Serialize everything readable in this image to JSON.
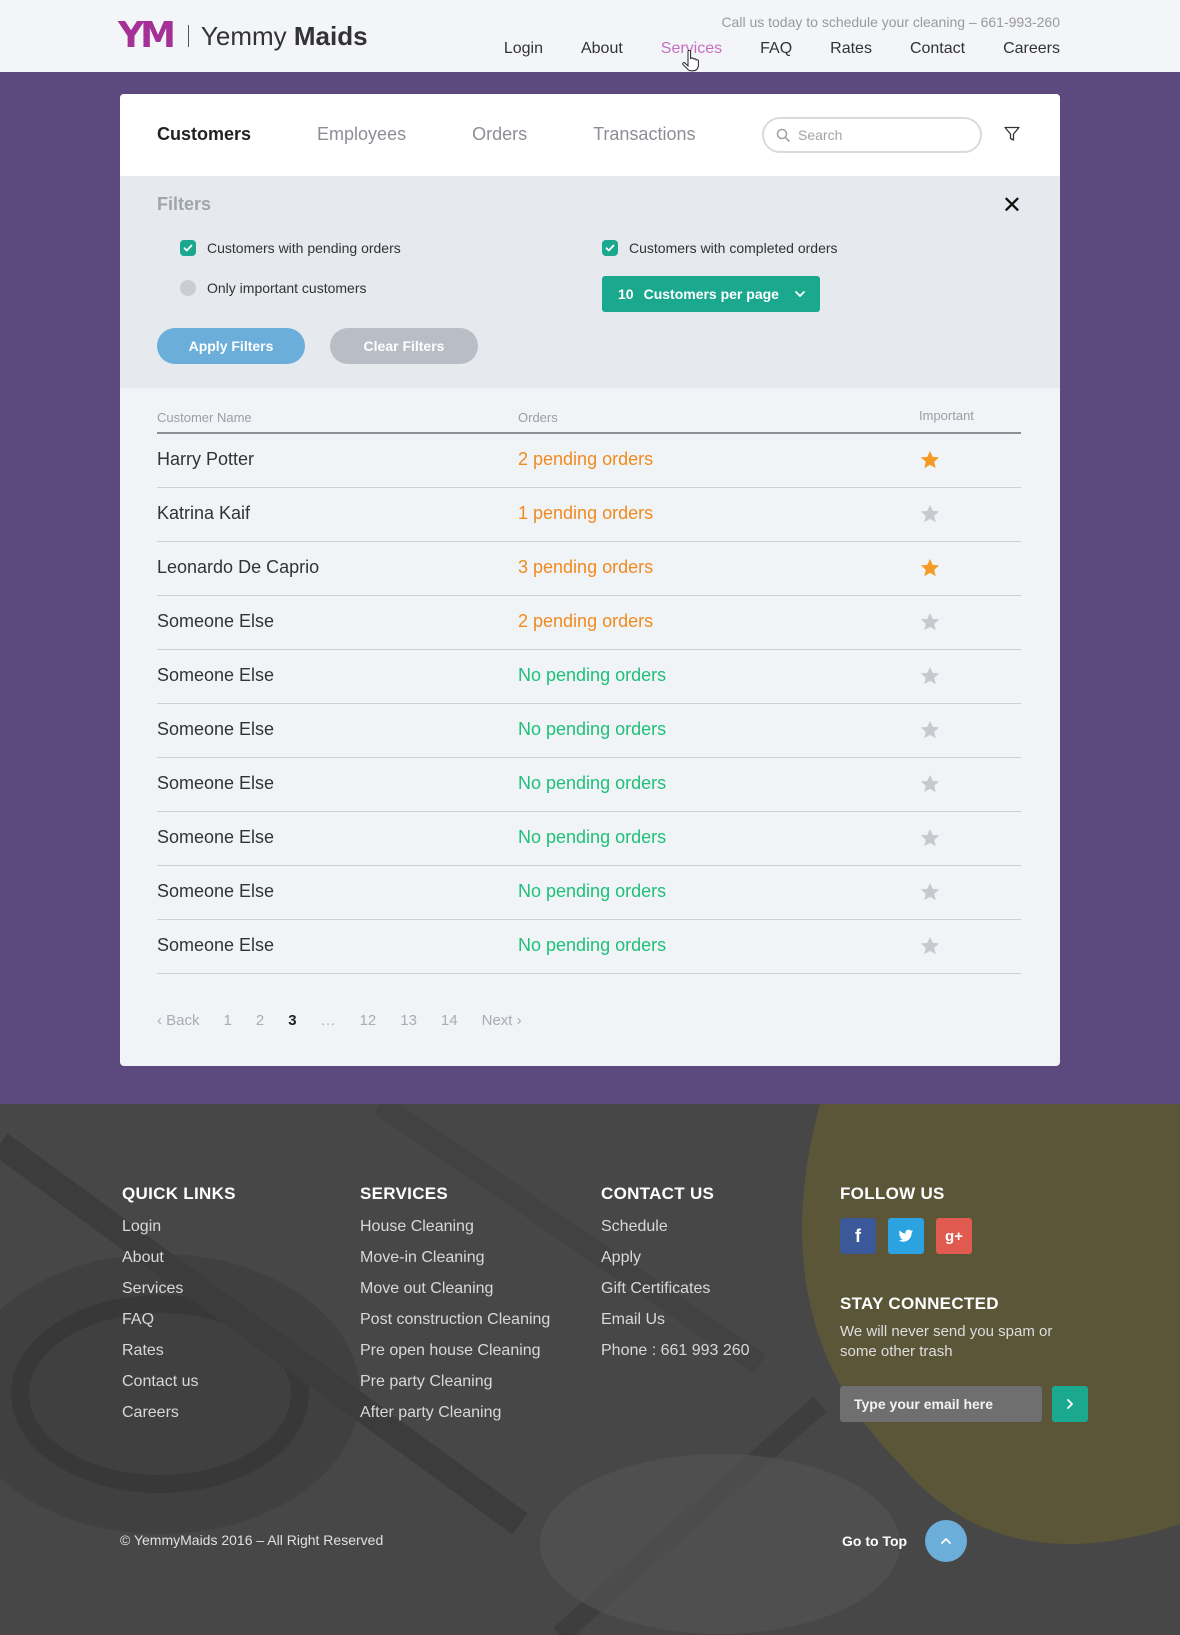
{
  "header": {
    "logo_mark": "YM",
    "logo_text_light": "Yemmy",
    "logo_text_bold": "Maids",
    "callus": "Call us today to schedule your cleaning – 661-993-260",
    "nav": [
      "Login",
      "About",
      "Services",
      "FAQ",
      "Rates",
      "Contact",
      "Careers"
    ],
    "active_nav": "Services"
  },
  "tabs": [
    "Customers",
    "Employees",
    "Orders",
    "Transactions"
  ],
  "active_tab": "Customers",
  "search": {
    "placeholder": "Search"
  },
  "filters": {
    "title": "Filters",
    "pending": "Customers with pending orders",
    "completed": "Customers with completed orders",
    "important": "Only important customers",
    "per_page_count": "10",
    "per_page_label": "Customers per page",
    "apply": "Apply Filters",
    "clear": "Clear Filters"
  },
  "table": {
    "headers": {
      "name": "Customer Name",
      "orders": "Orders",
      "important": "Important"
    },
    "rows": [
      {
        "name": "Harry Potter",
        "orders": "2 pending orders",
        "status": "pending",
        "important": true
      },
      {
        "name": "Katrina Kaif",
        "orders": "1 pending orders",
        "status": "pending",
        "important": false
      },
      {
        "name": "Leonardo De Caprio",
        "orders": "3 pending orders",
        "status": "pending",
        "important": true
      },
      {
        "name": "Someone Else",
        "orders": "2 pending orders",
        "status": "pending",
        "important": false
      },
      {
        "name": "Someone Else",
        "orders": "No pending orders",
        "status": "none",
        "important": false
      },
      {
        "name": "Someone Else",
        "orders": "No pending orders",
        "status": "none",
        "important": false
      },
      {
        "name": "Someone Else",
        "orders": "No pending orders",
        "status": "none",
        "important": false
      },
      {
        "name": "Someone Else",
        "orders": "No pending orders",
        "status": "none",
        "important": false
      },
      {
        "name": "Someone Else",
        "orders": "No pending orders",
        "status": "none",
        "important": false
      },
      {
        "name": "Someone Else",
        "orders": "No pending orders",
        "status": "none",
        "important": false
      }
    ]
  },
  "pager": {
    "back": "‹ Back",
    "pages": [
      "1",
      "2",
      "3",
      "…",
      "12",
      "13",
      "14"
    ],
    "current": "3",
    "next": "Next ›"
  },
  "footer": {
    "quick_links_title": "QUICK LINKS",
    "quick_links": [
      "Login",
      "About",
      "Services",
      "FAQ",
      "Rates",
      "Contact us",
      "Careers"
    ],
    "services_title": "SERVICES",
    "services": [
      "House Cleaning",
      "Move-in Cleaning",
      "Move out Cleaning",
      "Post construction Cleaning",
      "Pre open house Cleaning",
      "Pre party Cleaning",
      "After party Cleaning"
    ],
    "contact_title": "CONTACT US",
    "contact": [
      "Schedule",
      "Apply",
      "Gift Certificates",
      "Email Us",
      "Phone : 661 993 260"
    ],
    "follow_title": "FOLLOW US",
    "social": [
      {
        "icon": "facebook-icon",
        "glyph": "f",
        "color": "#3b5998"
      },
      {
        "icon": "twitter-icon",
        "glyph": "t",
        "color": "#2aa3e0"
      },
      {
        "icon": "google-plus-icon",
        "glyph": "g+",
        "color": "#e05a4f"
      }
    ],
    "stay_title": "STAY CONNECTED",
    "stay_text": "We will never send you spam or some other trash",
    "email_placeholder": "Type your email here",
    "copyright": "© YemmyMaids 2016 – All Right Reserved",
    "go_top": "Go to Top"
  },
  "colors": {
    "brand": "#a33196",
    "purple_bg": "#5c4a7f",
    "teal": "#1aa88f",
    "pending": "#f08a1e",
    "none": "#1fbf7a",
    "star_on": "#f59a23",
    "star_off": "#c6c9ce"
  }
}
